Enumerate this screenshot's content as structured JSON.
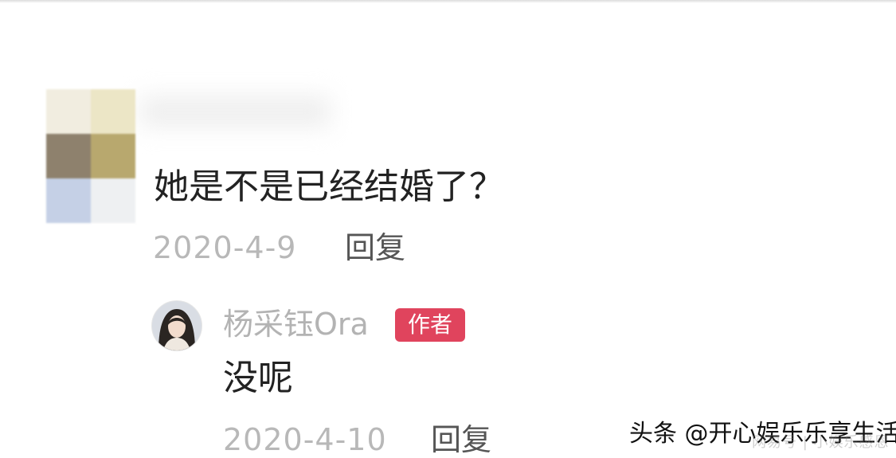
{
  "comment": {
    "text": "她是不是已经结婚了？",
    "date": "2020-4-9",
    "reply_label": "回复"
  },
  "reply": {
    "author_name": "杨采钰Ora",
    "author_badge": "作者",
    "text": "没呢",
    "date": "2020-4-10",
    "reply_label": "回复"
  },
  "watermark": {
    "text": "头条 @开心娱乐乐享生活",
    "subtext": "网易号 | 小娱乐感恩"
  },
  "colors": {
    "text_primary": "#222222",
    "text_meta": "#b8b8b8",
    "badge_bg": "#e0445d",
    "reply_button": "#555555"
  },
  "icons": {
    "commenter_avatar": "blurred-mosaic-avatar",
    "author_avatar": "profile-photo-avatar"
  }
}
